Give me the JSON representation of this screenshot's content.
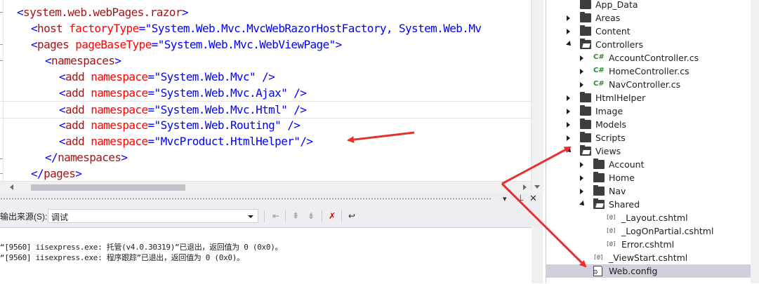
{
  "editor": {
    "lines": [
      {
        "indent": 1,
        "tokens": [
          [
            "p",
            "<"
          ],
          [
            "t",
            "system.web.webPages.razor"
          ],
          [
            "p",
            ">"
          ]
        ]
      },
      {
        "indent": 2,
        "tokens": [
          [
            "p",
            "<"
          ],
          [
            "t",
            "host"
          ],
          [
            "s",
            " "
          ],
          [
            "a",
            "factoryType"
          ],
          [
            "p",
            "=\""
          ],
          [
            "v",
            "System.Web.Mvc.MvcWebRazorHostFactory, System.Web.Mv"
          ]
        ]
      },
      {
        "indent": 2,
        "tokens": [
          [
            "p",
            "<"
          ],
          [
            "t",
            "pages"
          ],
          [
            "s",
            " "
          ],
          [
            "a",
            "pageBaseType"
          ],
          [
            "p",
            "=\""
          ],
          [
            "v",
            "System.Web.Mvc.WebViewPage"
          ],
          [
            "p",
            "\">"
          ]
        ]
      },
      {
        "indent": 3,
        "tokens": [
          [
            "p",
            "<"
          ],
          [
            "t",
            "namespaces"
          ],
          [
            "p",
            ">"
          ]
        ]
      },
      {
        "indent": 4,
        "tokens": [
          [
            "p",
            "<"
          ],
          [
            "t",
            "add"
          ],
          [
            "s",
            " "
          ],
          [
            "a",
            "namespace"
          ],
          [
            "p",
            "=\""
          ],
          [
            "v",
            "System.Web.Mvc"
          ],
          [
            "p",
            "\" />"
          ]
        ]
      },
      {
        "indent": 4,
        "tokens": [
          [
            "p",
            "<"
          ],
          [
            "t",
            "add"
          ],
          [
            "s",
            " "
          ],
          [
            "a",
            "namespace"
          ],
          [
            "p",
            "=\""
          ],
          [
            "v",
            "System.Web.Mvc.Ajax"
          ],
          [
            "p",
            "\" />"
          ]
        ]
      },
      {
        "indent": 4,
        "tokens": [
          [
            "p",
            "<"
          ],
          [
            "t",
            "add"
          ],
          [
            "s",
            " "
          ],
          [
            "a",
            "namespace"
          ],
          [
            "p",
            "=\""
          ],
          [
            "v",
            "System.Web.Mvc.Html"
          ],
          [
            "p",
            "\" />"
          ]
        ]
      },
      {
        "indent": 4,
        "tokens": [
          [
            "p",
            "<"
          ],
          [
            "t",
            "add"
          ],
          [
            "s",
            " "
          ],
          [
            "a",
            "namespace"
          ],
          [
            "p",
            "=\""
          ],
          [
            "v",
            "System.Web.Routing"
          ],
          [
            "p",
            "\" />"
          ]
        ]
      },
      {
        "indent": 4,
        "tokens": [
          [
            "p",
            "<"
          ],
          [
            "t",
            "add"
          ],
          [
            "s",
            " "
          ],
          [
            "a",
            "namespace"
          ],
          [
            "p",
            "=\""
          ],
          [
            "v",
            "MvcProduct.HtmlHelper"
          ],
          [
            "p",
            "\"/>"
          ]
        ]
      },
      {
        "indent": 3,
        "tokens": [
          [
            "p",
            "</"
          ],
          [
            "t",
            "namespaces"
          ],
          [
            "p",
            ">"
          ]
        ]
      },
      {
        "indent": 2,
        "tokens": [
          [
            "p",
            "</"
          ],
          [
            "t",
            "pages"
          ],
          [
            "p",
            ">"
          ]
        ]
      },
      {
        "indent": 1,
        "tokens": [
          [
            "p",
            "</"
          ],
          [
            "t",
            "system.web.webPages.razor"
          ],
          [
            "p",
            ">"
          ]
        ]
      }
    ]
  },
  "output": {
    "source_label": "输出来源(S):",
    "source_value": "调试",
    "lines": [
      "“[9560] iisexpress.exe: 托管(v4.0.30319)”已退出，返回值为 0 (0x0)。",
      "“[9560] iisexpress.exe: 程序跟踪”已退出，返回值为 0 (0x0)。"
    ]
  },
  "solution_explorer": {
    "items": [
      {
        "label": "App_Data",
        "level": 1,
        "kind": "folder",
        "arrow": "none"
      },
      {
        "label": "Areas",
        "level": 1,
        "kind": "folder",
        "arrow": "collapsed"
      },
      {
        "label": "Content",
        "level": 1,
        "kind": "folder",
        "arrow": "collapsed"
      },
      {
        "label": "Controllers",
        "level": 1,
        "kind": "folder-open",
        "arrow": "expanded"
      },
      {
        "label": "AccountController.cs",
        "level": 2,
        "kind": "cs",
        "arrow": "collapsed"
      },
      {
        "label": "HomeController.cs",
        "level": 2,
        "kind": "cs",
        "arrow": "collapsed"
      },
      {
        "label": "NavController.cs",
        "level": 2,
        "kind": "cs",
        "arrow": "collapsed"
      },
      {
        "label": "HtmlHelper",
        "level": 1,
        "kind": "folder",
        "arrow": "collapsed"
      },
      {
        "label": "Image",
        "level": 1,
        "kind": "folder",
        "arrow": "collapsed"
      },
      {
        "label": "Models",
        "level": 1,
        "kind": "folder",
        "arrow": "collapsed"
      },
      {
        "label": "Scripts",
        "level": 1,
        "kind": "folder",
        "arrow": "collapsed"
      },
      {
        "label": "Views",
        "level": 1,
        "kind": "folder-open",
        "arrow": "expanded"
      },
      {
        "label": "Account",
        "level": 2,
        "kind": "folder",
        "arrow": "collapsed"
      },
      {
        "label": "Home",
        "level": 2,
        "kind": "folder",
        "arrow": "collapsed"
      },
      {
        "label": "Nav",
        "level": 2,
        "kind": "folder",
        "arrow": "collapsed"
      },
      {
        "label": "Shared",
        "level": 2,
        "kind": "folder-open",
        "arrow": "expanded"
      },
      {
        "label": "_Layout.cshtml",
        "level": 3,
        "kind": "cshtml",
        "arrow": "none"
      },
      {
        "label": "_LogOnPartial.cshtml",
        "level": 3,
        "kind": "cshtml",
        "arrow": "none"
      },
      {
        "label": "Error.cshtml",
        "level": 3,
        "kind": "cshtml",
        "arrow": "none"
      },
      {
        "label": "_ViewStart.cshtml",
        "level": 2,
        "kind": "cshtml",
        "arrow": "none"
      },
      {
        "label": "Web.config",
        "level": 2,
        "kind": "config",
        "arrow": "none",
        "selected": true
      }
    ]
  },
  "colors": {
    "annotation_arrow": "#e8312e",
    "selection": "#d0d0dc"
  }
}
